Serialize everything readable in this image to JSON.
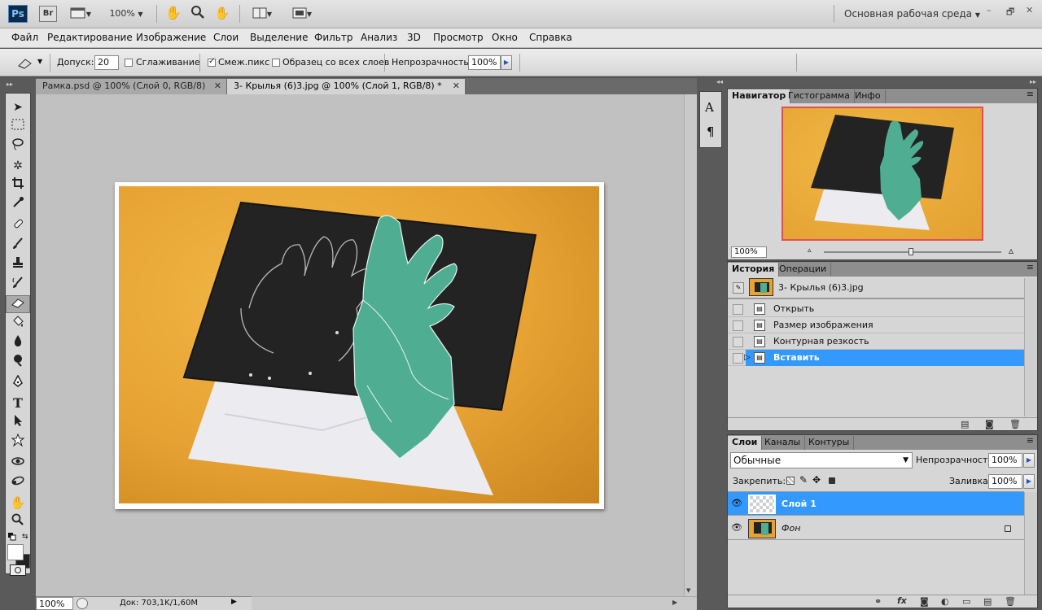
{
  "app": {
    "logo": "Ps",
    "bridge": "Br",
    "zoom": "100%",
    "workspace": "Основная рабочая среда",
    "win_min": "–",
    "win_restore": "🗗",
    "win_close": "✕"
  },
  "menu": [
    "Файл",
    "Редактирование",
    "Изображение",
    "Слои",
    "Выделение",
    "Фильтр",
    "Анализ",
    "3D",
    "Просмотр",
    "Окно",
    "Справка"
  ],
  "options": {
    "tolerance_label": "Допуск:",
    "tolerance_value": "20",
    "antialias_label": "Сглаживание",
    "contiguous_label": "Смеж.пикс",
    "sample_all_label": "Образец со всех слоев",
    "opacity_label": "Непрозрачность:",
    "opacity_value": "100%"
  },
  "tabs": [
    {
      "label": "Рамка.psd @ 100% (Слой 0, RGB/8)",
      "active": false
    },
    {
      "label": "3- Крылья (6)3.jpg @ 100% (Слой 1, RGB/8) *",
      "active": true
    }
  ],
  "status": {
    "zoom": "100%",
    "doc": "Док: 703,1K/1,60M"
  },
  "navigator": {
    "tabs": [
      "Навигатор",
      "Гистограмма",
      "Инфо"
    ],
    "zoom": "100%"
  },
  "history": {
    "tabs": [
      "История",
      "Операции"
    ],
    "snapshot": "3- Крылья (6)3.jpg",
    "items": [
      "Открыть",
      "Размер изображения",
      "Контурная резкость",
      "Вставить"
    ],
    "selected_index": 3
  },
  "layers": {
    "tabs": [
      "Слои",
      "Каналы",
      "Контуры"
    ],
    "blend_mode": "Обычные",
    "opacity_label": "Непрозрачность:",
    "opacity_value": "100%",
    "lock_label": "Закрепить:",
    "fill_label": "Заливка:",
    "fill_value": "100%",
    "items": [
      {
        "name": "Слой 1",
        "selected": true
      },
      {
        "name": "Фон",
        "locked": true
      }
    ],
    "footer_icons": [
      "link-icon",
      "fx-icon",
      "mask-icon",
      "adjustment-icon",
      "group-icon",
      "new-layer-icon",
      "trash-icon"
    ]
  },
  "colors": {
    "accent": "#3399ff",
    "photo_orange": "#e6a232",
    "felt": "#232323",
    "paper_green": "#4fae92"
  }
}
